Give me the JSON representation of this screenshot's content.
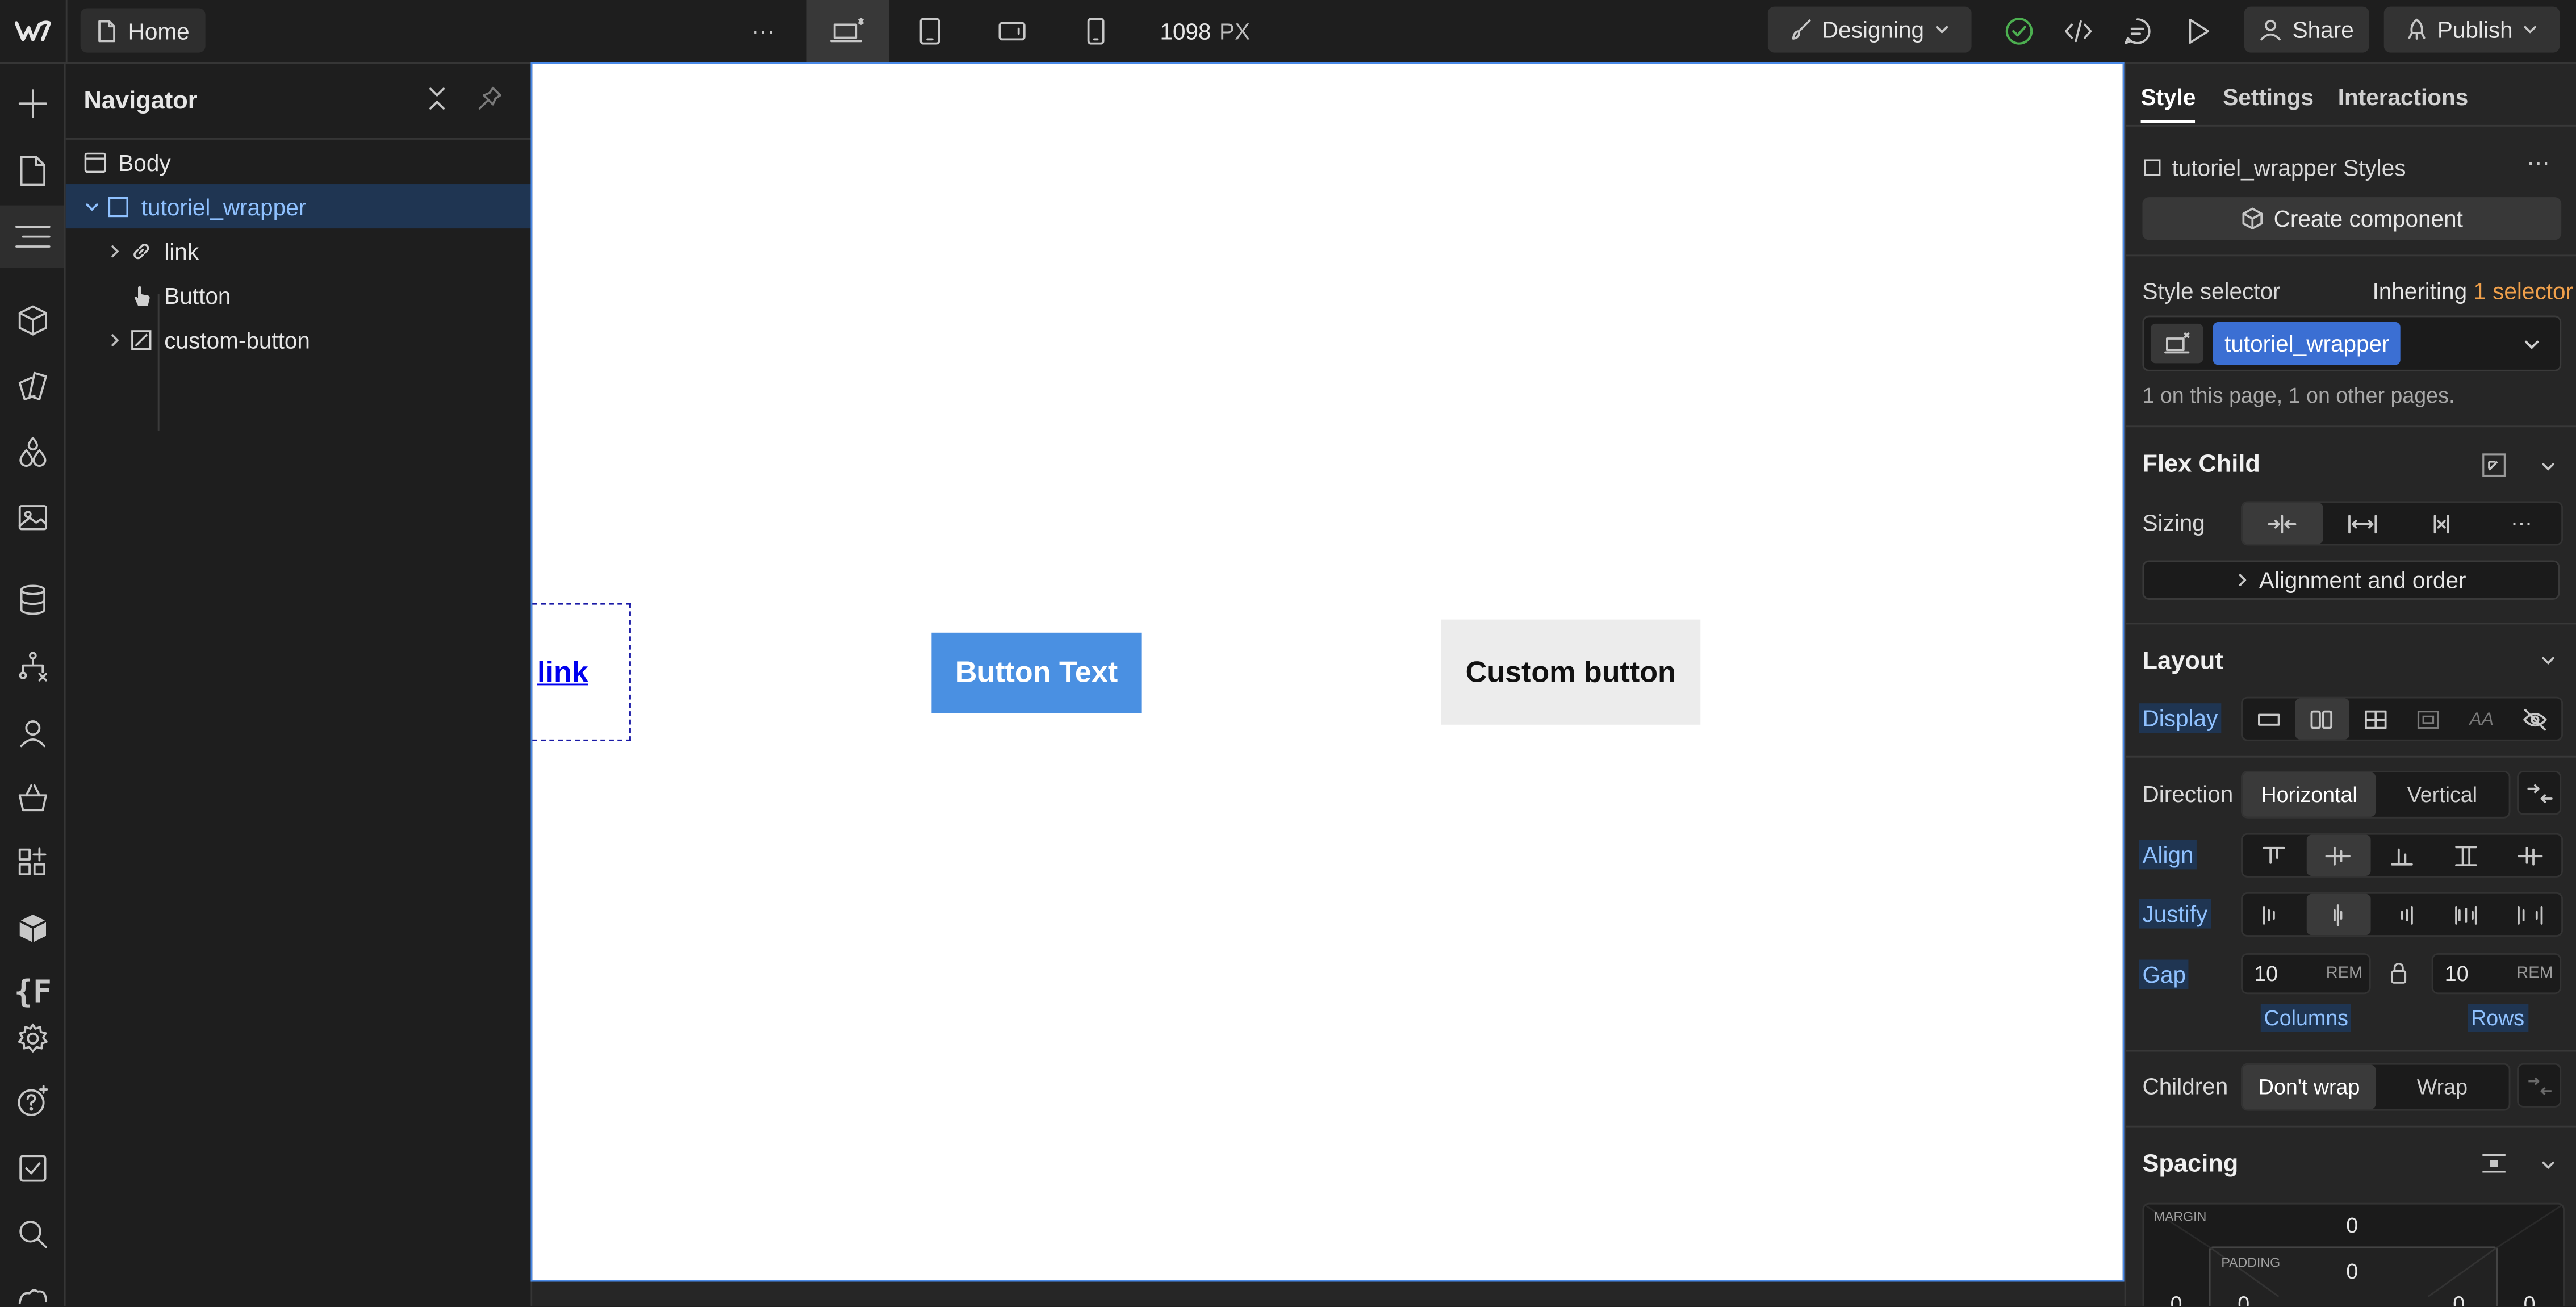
{
  "topbar": {
    "page_name": "Home",
    "more": "⋯",
    "width_value": "1098",
    "width_unit": "PX",
    "mode_label": "Designing",
    "share_label": "Share",
    "publish_label": "Publish"
  },
  "navigator": {
    "title": "Navigator",
    "items": [
      {
        "label": "Body",
        "icon": "body-icon"
      },
      {
        "label": "tutoriel_wrapper",
        "icon": "div-block-icon",
        "selected": true
      },
      {
        "label": "link",
        "icon": "link-icon"
      },
      {
        "label": "Button",
        "icon": "pointer-icon"
      },
      {
        "label": "custom-button",
        "icon": "component-icon"
      }
    ]
  },
  "canvas": {
    "link_text": "link",
    "button_text": "Button Text",
    "custom_button_text": "Custom button"
  },
  "panel": {
    "tabs": [
      "Style",
      "Settings",
      "Interactions"
    ],
    "element_styles": "tutoriel_wrapper Styles",
    "create_component": "Create component",
    "style_selector_label": "Style selector",
    "inheriting": "Inheriting",
    "inheriting_count": "1 selector",
    "selector_chip": "tutoriel_wrapper",
    "selector_note": "1 on this page, 1 on other pages.",
    "flex_child": {
      "title": "Flex Child",
      "sizing_label": "Sizing",
      "alignment_label": "Alignment and order"
    },
    "layout": {
      "title": "Layout",
      "display_label": "Display",
      "direction_label": "Direction",
      "direction_options": [
        "Horizontal",
        "Vertical"
      ],
      "align_label": "Align",
      "justify_label": "Justify",
      "gap_label": "Gap",
      "gap_columns": "10",
      "gap_rows": "10",
      "gap_unit": "REM",
      "columns_label": "Columns",
      "rows_label": "Rows",
      "children_label": "Children",
      "children_options": [
        "Don't wrap",
        "Wrap"
      ]
    },
    "spacing": {
      "title": "Spacing",
      "margin_label": "MARGIN",
      "padding_label": "PADDING",
      "margin_top": "0",
      "padding_top": "0",
      "margin_left": "0",
      "padding_left": "0",
      "padding_right": "0",
      "margin_right": "0"
    }
  },
  "colors": {
    "accent": "#4a90e2",
    "selection_bg": "#1f3552",
    "inheriting_accent": "#f0a04b",
    "status_ok": "#4caf50"
  }
}
